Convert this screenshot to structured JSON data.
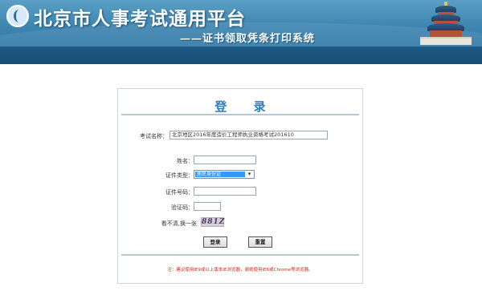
{
  "header": {
    "title": "北京市人事考试通用平台",
    "subtitle": "——证书领取凭条打印系统"
  },
  "login": {
    "title": "登 录",
    "exam_name_label": "考试名称：",
    "exam_name_value": "北京地区2016年度造价工程师执业资格考试201610",
    "name_label": "姓名：",
    "name_value": "",
    "id_type_label": "证件类型：",
    "id_type_value": "居民身份证",
    "id_number_label": "证件号码：",
    "id_number_value": "",
    "captcha_label": "验证码：",
    "captcha_value": "",
    "captcha_refresh_label": "看不清,换一张",
    "captcha_image_text": "881Z",
    "login_button": "登录",
    "reset_button": "重置",
    "note": "注：建议使用IE9或以上版本IE浏览器，谢绝使用IE6或Chrome等浏览器。"
  },
  "colors": {
    "header_blue": "#3e86b2",
    "header_band": "#164d75",
    "title_blue": "#2a7fbf",
    "note_red": "#cc2a1a",
    "select_highlight": "#3399ff"
  }
}
